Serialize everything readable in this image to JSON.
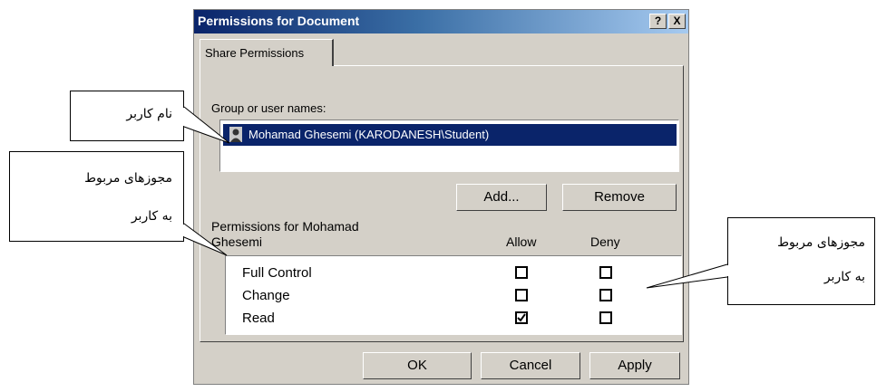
{
  "dialog": {
    "title": "Permissions for Document",
    "help_btn": "?",
    "close_btn": "X",
    "tab_label": "Share Permissions",
    "group_label": "Group or user names:",
    "selected_user": "Mohamad Ghesemi (KARODANESH\\Student)",
    "add_btn": "Add...",
    "remove_btn": "Remove",
    "permissions_title": "Permissions for Mohamad Ghesemi",
    "allow_header": "Allow",
    "deny_header": "Deny",
    "permissions": [
      {
        "name": "Full Control",
        "allow": false,
        "deny": false
      },
      {
        "name": "Change",
        "allow": false,
        "deny": false
      },
      {
        "name": "Read",
        "allow": true,
        "deny": false
      }
    ],
    "ok_btn": "OK",
    "cancel_btn": "Cancel",
    "apply_btn": "Apply"
  },
  "callouts": {
    "user_name": "نام کاربر",
    "user_permissions_line1": "مجوزهای مربوط",
    "user_permissions_line2": "به کاربر",
    "right_line1": "مجوزهای مربوط",
    "right_line2": "به کاربر"
  }
}
